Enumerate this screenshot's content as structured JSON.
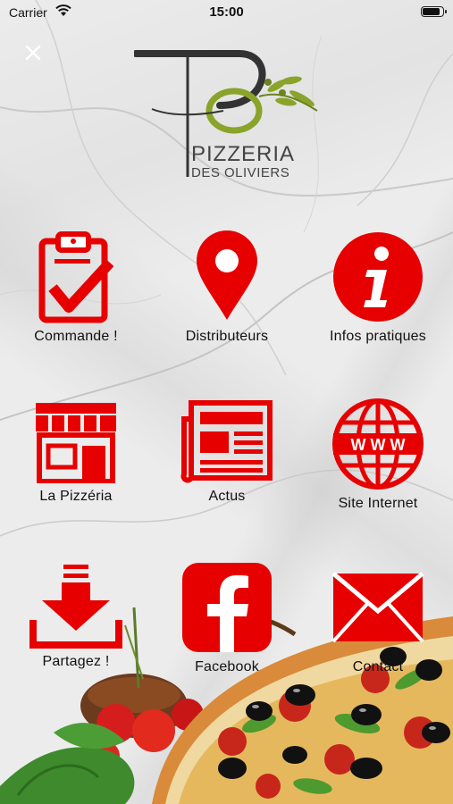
{
  "status_bar": {
    "carrier": "Carrier",
    "time": "15:00"
  },
  "logo": {
    "line1": "PIZZERIA",
    "line2": "DES OLIVIERS"
  },
  "accent_color": "#e60000",
  "menu": [
    {
      "label": "Commande !",
      "icon": "clipboard-check-icon"
    },
    {
      "label": "Distributeurs",
      "icon": "map-pin-icon"
    },
    {
      "label": "Infos pratiques",
      "icon": "info-icon"
    },
    {
      "label": "La Pizzéria",
      "icon": "storefront-icon"
    },
    {
      "label": "Actus",
      "icon": "newspaper-icon"
    },
    {
      "label": "Site Internet",
      "icon": "globe-www-icon"
    },
    {
      "label": "Partagez !",
      "icon": "download-share-icon"
    },
    {
      "label": "Facebook",
      "icon": "facebook-icon"
    },
    {
      "label": "Contact",
      "icon": "envelope-icon"
    }
  ]
}
